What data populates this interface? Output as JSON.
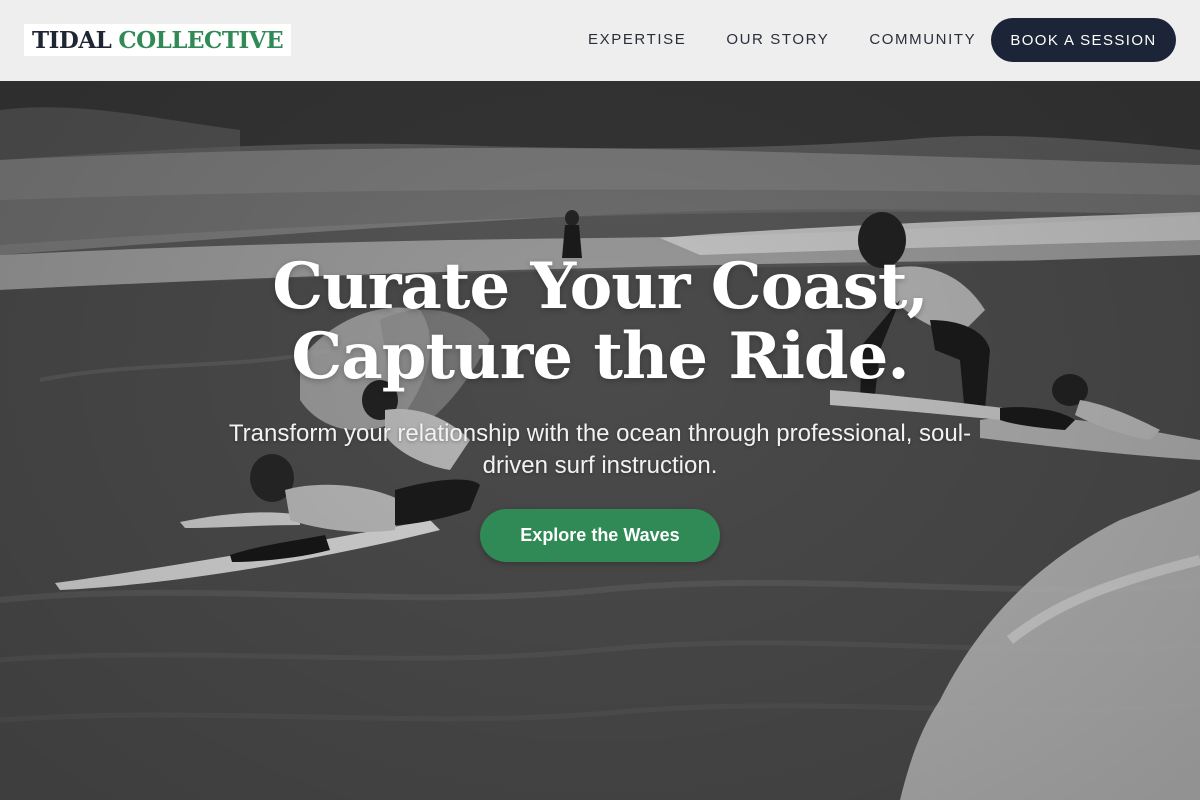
{
  "brand": {
    "word1": "TIDAL",
    "word2": "COLLECTIVE",
    "accent_color": "#2f8a55",
    "dark_color": "#1c2438"
  },
  "nav": {
    "items": [
      {
        "label": "EXPERTISE"
      },
      {
        "label": "OUR STORY"
      },
      {
        "label": "COMMUNITY"
      }
    ],
    "cta_label": "BOOK A SESSION"
  },
  "hero": {
    "headline_line1": "Curate Your Coast,",
    "headline_line2": "Capture the Ride.",
    "subheading": "Transform your relationship with the ocean through professional, soul-driven surf instruction.",
    "cta_label": "Explore the Waves",
    "image_style": "grayscale"
  }
}
